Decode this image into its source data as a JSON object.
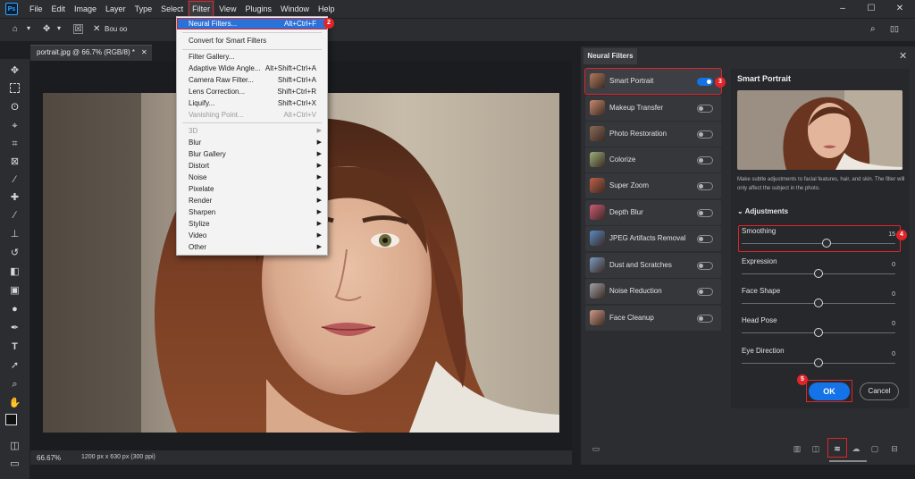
{
  "menubar": {
    "items": [
      "File",
      "Edit",
      "Image",
      "Layer",
      "Type",
      "Select",
      "Filter",
      "View",
      "Plugins",
      "Window",
      "Help"
    ],
    "active": "Filter",
    "window_controls": [
      "–",
      "☐",
      "✕"
    ]
  },
  "optionsbar": {
    "label": "Bou oo"
  },
  "document": {
    "tab_title": "portrait.jpg @ 66.7% (RGB/8) *",
    "zoom": "66.67%",
    "info": "1200 px x 630 px (300 ppi)"
  },
  "filter_menu": {
    "items": [
      {
        "label": "Neural Filters...",
        "shortcut": "Alt+Ctrl+F",
        "highlight": true
      },
      {
        "label": "Convert for Smart Filters",
        "shortcut": ""
      },
      {
        "label": "Filter Gallery...",
        "shortcut": ""
      },
      {
        "label": "Adaptive Wide Angle...",
        "shortcut": "Alt+Shift+Ctrl+A"
      },
      {
        "label": "Camera Raw Filter...",
        "shortcut": "Shift+Ctrl+A"
      },
      {
        "label": "Lens Correction...",
        "shortcut": "Shift+Ctrl+R"
      },
      {
        "label": "Liquify...",
        "shortcut": "Shift+Ctrl+X"
      },
      {
        "label": "Vanishing Point...",
        "shortcut": "Alt+Ctrl+V",
        "disabled": true
      },
      {
        "label": "3D",
        "submenu": true,
        "disabled": true
      },
      {
        "label": "Blur",
        "submenu": true
      },
      {
        "label": "Blur Gallery",
        "submenu": true
      },
      {
        "label": "Distort",
        "submenu": true
      },
      {
        "label": "Noise",
        "submenu": true
      },
      {
        "label": "Pixelate",
        "submenu": true
      },
      {
        "label": "Render",
        "submenu": true
      },
      {
        "label": "Sharpen",
        "submenu": true
      },
      {
        "label": "Stylize",
        "submenu": true
      },
      {
        "label": "Video",
        "submenu": true
      },
      {
        "label": "Other",
        "submenu": true
      }
    ]
  },
  "neural_filters": {
    "tab": "Neural Filters",
    "filters": [
      {
        "label": "Smart Portrait",
        "on": true,
        "color": "#b07a5c"
      },
      {
        "label": "Makeup Transfer",
        "on": false,
        "color": "#c98a6e"
      },
      {
        "label": "Photo Restoration",
        "on": false,
        "color": "#8a6a5a"
      },
      {
        "label": "Colorize",
        "on": false,
        "color": "#9bb07a"
      },
      {
        "label": "Super Zoom",
        "on": false,
        "color": "#c06048"
      },
      {
        "label": "Depth Blur",
        "on": false,
        "color": "#d05a78"
      },
      {
        "label": "JPEG Artifacts Removal",
        "on": false,
        "color": "#5a8ac8"
      },
      {
        "label": "Dust and Scratches",
        "on": false,
        "color": "#7a9ac0"
      },
      {
        "label": "Noise Reduction",
        "on": false,
        "color": "#a0a0a8"
      },
      {
        "label": "Face Cleanup",
        "on": false,
        "color": "#d09a88"
      }
    ],
    "detail": {
      "title": "Smart Portrait",
      "description": "Make subtle adjustments to facial features, hair, and skin. The filter will only affect the subject in the photo.",
      "adjustments_label": "Adjustments",
      "sliders": [
        {
          "name": "Smoothing",
          "value": "15",
          "position": 0.55
        },
        {
          "name": "Expression",
          "value": "0",
          "position": 0.5
        },
        {
          "name": "Face Shape",
          "value": "0",
          "position": 0.5
        },
        {
          "name": "Head Pose",
          "value": "0",
          "position": 0.5
        },
        {
          "name": "Eye Direction",
          "value": "0",
          "position": 0.5
        }
      ],
      "ok_label": "OK",
      "cancel_label": "Cancel"
    }
  },
  "step_badges": [
    "2",
    "3",
    "4",
    "5"
  ],
  "colors": {
    "accent": "#1473e6",
    "annotation": "#e0242a"
  }
}
